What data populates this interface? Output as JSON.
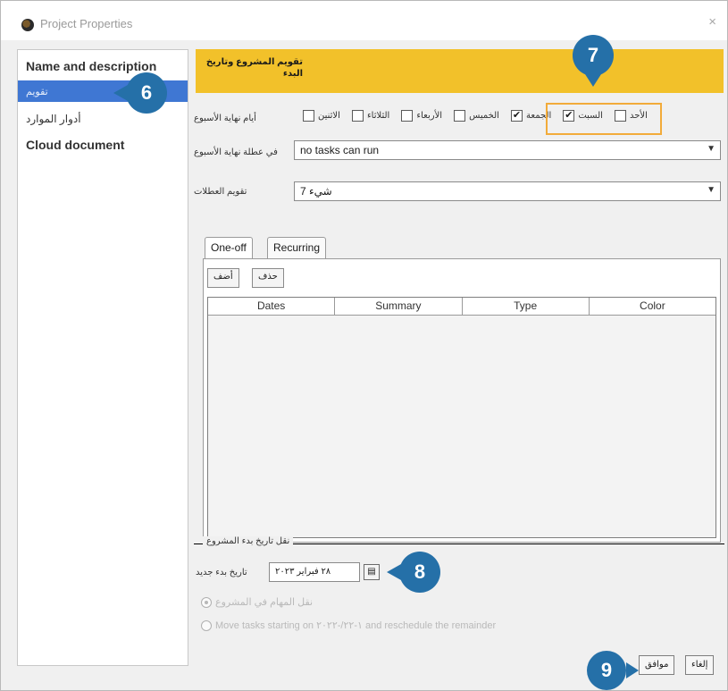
{
  "window": {
    "title": "Project Properties",
    "close_glyph": "×"
  },
  "sidebar": {
    "items": [
      {
        "label": "Name and description"
      },
      {
        "label": "تقويم"
      },
      {
        "label": "أدوار الموارد"
      },
      {
        "label": "Cloud document"
      }
    ]
  },
  "banner": {
    "text": "تقويم المشروع وتاريخ البدء"
  },
  "weekend": {
    "label": "أيام نهاية الأسبوع",
    "days": [
      {
        "name": "الاثنين",
        "checked": false
      },
      {
        "name": "الثلاثاء",
        "checked": false
      },
      {
        "name": "الأربعاء",
        "checked": false
      },
      {
        "name": "الخميس",
        "checked": false
      },
      {
        "name": "الجمعة",
        "checked": true
      },
      {
        "name": "السبت",
        "checked": true
      },
      {
        "name": "الأحد",
        "checked": false
      }
    ]
  },
  "on_weekend": {
    "label": "في عطلة نهاية الأسبوع",
    "value": "no tasks can run"
  },
  "calendar_field": {
    "label": "تقويم العطلات",
    "value": "7 شيء"
  },
  "tabs": {
    "one_off": "One-off",
    "recurring": "Recurring"
  },
  "buttons": {
    "delete": "حذف",
    "add": "أضف",
    "ok": "موافق",
    "cancel": "إلغاء"
  },
  "table": {
    "headers": [
      "Dates",
      "Summary",
      "Type",
      "Color"
    ]
  },
  "start_section": {
    "title": "نقل تاريخ بدء المشروع",
    "new_date_label": "تاريخ بدء جديد",
    "date_value": "٢٨ فبراير ٢٠٢٣",
    "option_move": "نقل المهام في المشروع",
    "option_reschedule": "Move tasks starting on ١-٢٢/-٢٠٢٢ and reschedule the remainder"
  },
  "callouts": {
    "c6": "6",
    "c7": "7",
    "c8": "8",
    "c9": "9"
  },
  "colors": {
    "accent_blue": "#2570a8",
    "banner_yellow": "#f2c12a",
    "highlight_orange": "#f2ab3a",
    "selection_blue": "#3f77d3"
  }
}
